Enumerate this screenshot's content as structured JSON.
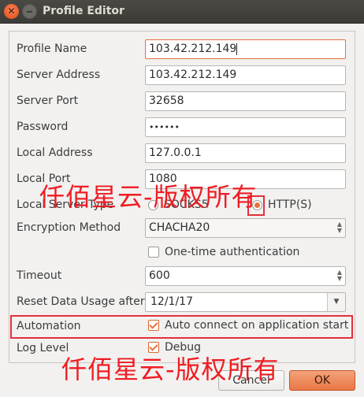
{
  "window": {
    "title": "Profile Editor",
    "close_glyph": "✕"
  },
  "form": {
    "profile_name": {
      "label": "Profile Name",
      "value": "103.42.212.149"
    },
    "server_address": {
      "label": "Server Address",
      "value": "103.42.212.149"
    },
    "server_port": {
      "label": "Server Port",
      "value": "32658"
    },
    "password": {
      "label": "Password",
      "value": "••••••"
    },
    "local_address": {
      "label": "Local Address",
      "value": "127.0.0.1"
    },
    "local_port": {
      "label": "Local Port",
      "value": "1080"
    },
    "local_server_type": {
      "label": "Local Server Type",
      "options": [
        "SOCKS5",
        "HTTP(S)"
      ],
      "selected": "HTTP(S)"
    },
    "encryption_method": {
      "label": "Encryption Method",
      "value": "CHACHA20"
    },
    "one_time_auth": {
      "label": "One-time authentication",
      "checked": false
    },
    "timeout": {
      "label": "Timeout",
      "value": "600"
    },
    "reset_data_usage": {
      "label": "Reset Data Usage after",
      "value": "12/1/17"
    },
    "automation": {
      "label": "Automation",
      "checkbox_label": "Auto connect on application start",
      "checked": true
    },
    "log_level": {
      "label": "Log Level",
      "checkbox_label": "Debug",
      "checked": true
    }
  },
  "buttons": {
    "cancel": "Cancel",
    "ok": "OK"
  },
  "watermark": {
    "text1": "仟佰星云-版权所有",
    "text2": "仟佰星云-版权所有",
    "color": "#ee1d23"
  },
  "colors": {
    "accent": "#e9713f",
    "highlight_box": "#e2303a",
    "titlebar": "#3c3b37"
  }
}
